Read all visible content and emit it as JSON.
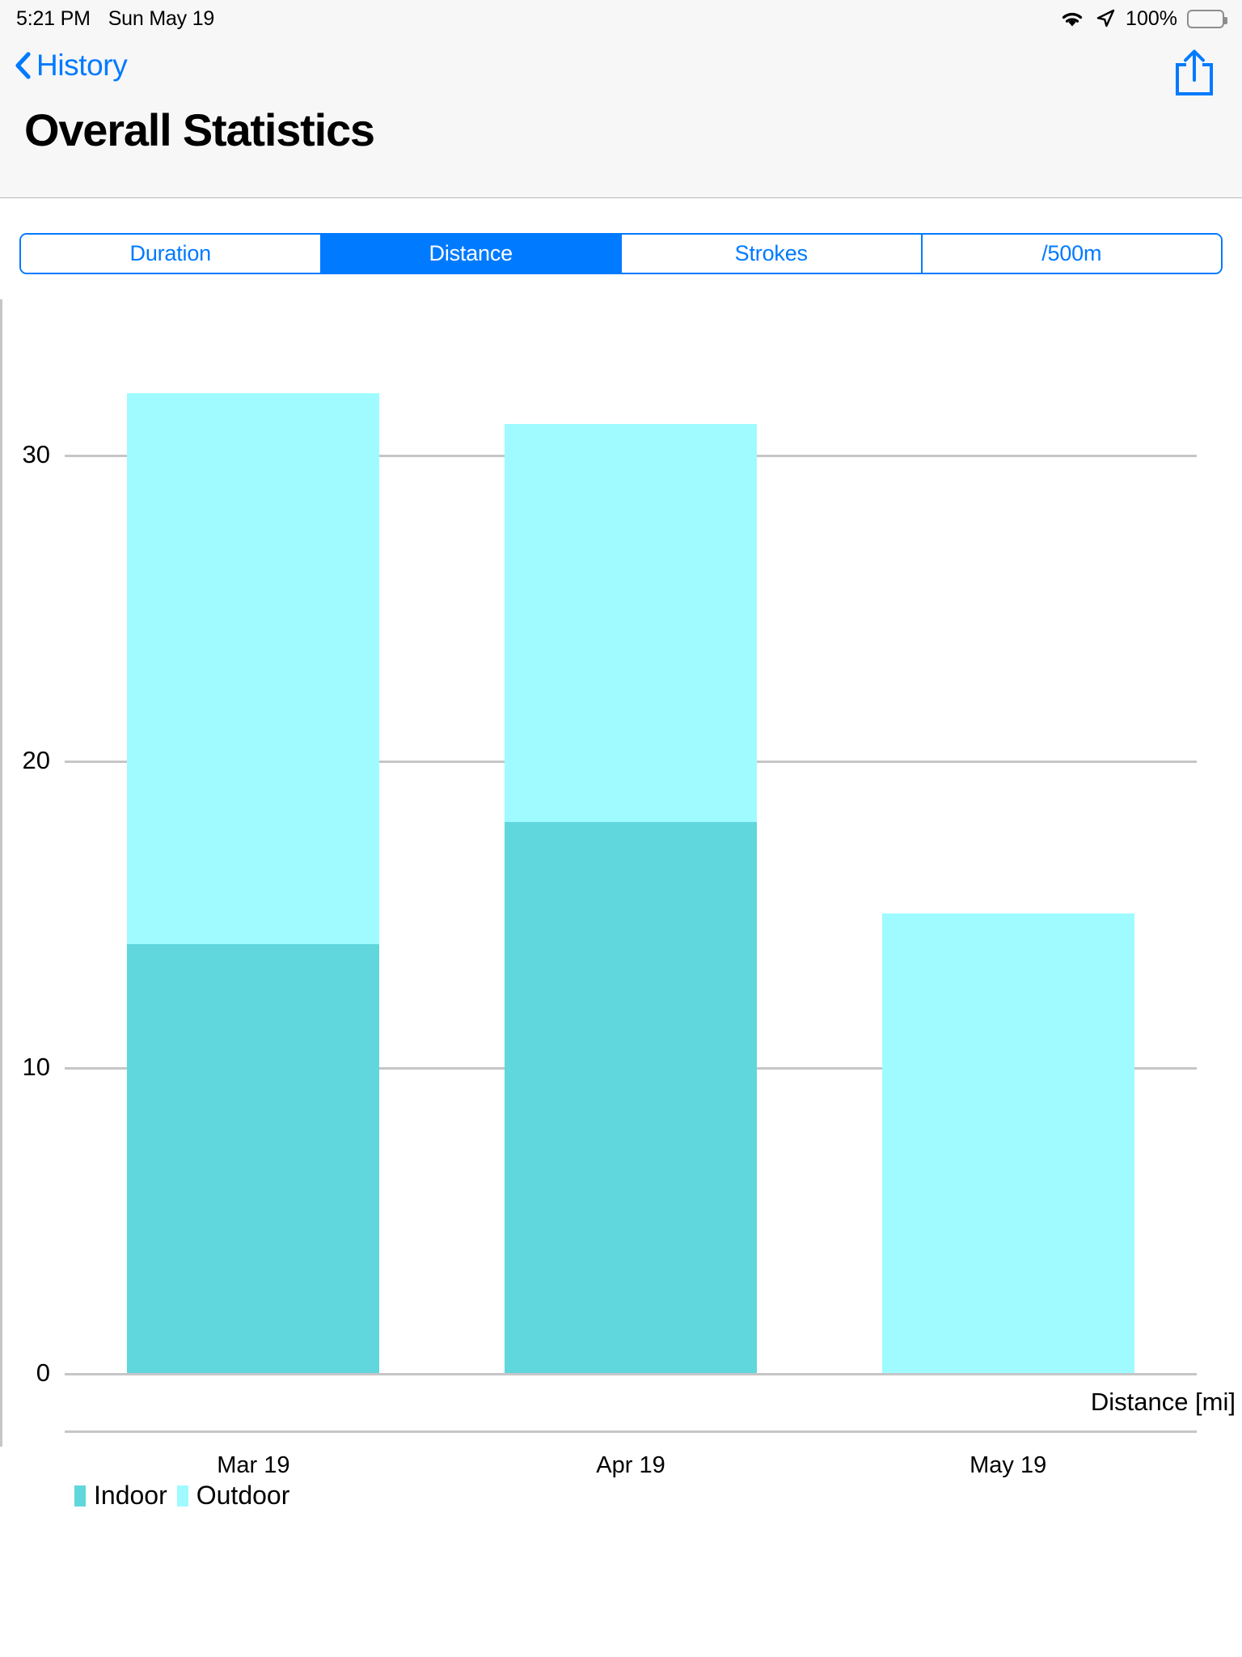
{
  "statusbar": {
    "time": "5:21 PM",
    "date": "Sun May 19",
    "battery_percent": "100%",
    "wifi_icon": "wifi-icon",
    "location_icon": "location-arrow-icon",
    "battery_icon": "battery-full-icon"
  },
  "navbar": {
    "back_label": "History",
    "back_icon": "chevron-left-icon",
    "share_icon": "share-icon",
    "title": "Overall Statistics",
    "tint_color": "#007aff"
  },
  "segmented_control": {
    "segments": [
      {
        "label": "Duration",
        "selected": false
      },
      {
        "label": "Distance",
        "selected": true
      },
      {
        "label": "Strokes",
        "selected": false
      },
      {
        "label": "/500m",
        "selected": false
      }
    ]
  },
  "chart_data": {
    "type": "bar",
    "stacked": true,
    "title": "",
    "xlabel": "",
    "ylabel": "Distance [mi]",
    "categories": [
      "Mar 19",
      "Apr 19",
      "May 19"
    ],
    "yticks": [
      0,
      10,
      20,
      30
    ],
    "ylim": [
      0,
      35
    ],
    "grid": true,
    "legend_position": "bottom-left",
    "series": [
      {
        "name": "Indoor",
        "color": "#5fd7dc",
        "values": [
          14,
          18,
          0
        ]
      },
      {
        "name": "Outdoor",
        "color": "#9ffbff",
        "values": [
          18,
          13,
          15
        ]
      }
    ],
    "totals": [
      32,
      31,
      15
    ]
  }
}
